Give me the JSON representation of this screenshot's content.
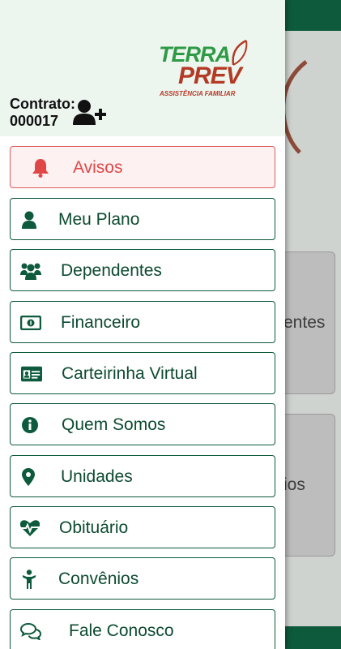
{
  "header": {
    "logo_terra": "TERRA",
    "logo_prev": "PREV",
    "logo_sub": "ASSISTÊNCIA FAMILIAR",
    "contract_label": "Contrato:",
    "contract_number": "000017",
    "add_user_icon": "user-plus-icon"
  },
  "background": {
    "card1_text": "entes",
    "card2_text": "ios"
  },
  "menu": {
    "items": [
      {
        "label": "Avisos",
        "icon": "bell-icon"
      },
      {
        "label": "Meu Plano",
        "icon": "user-icon"
      },
      {
        "label": "Dependentes",
        "icon": "users-icon"
      },
      {
        "label": "Financeiro",
        "icon": "money-bill-icon"
      },
      {
        "label": "Carteirinha Virtual",
        "icon": "id-card-icon"
      },
      {
        "label": "Quem Somos",
        "icon": "info-circle-icon"
      },
      {
        "label": "Unidades",
        "icon": "map-marker-icon"
      },
      {
        "label": "Obituário",
        "icon": "heartbeat-icon"
      },
      {
        "label": "Convênios",
        "icon": "child-icon"
      },
      {
        "label": "Fale Conosco",
        "icon": "comments-icon"
      }
    ]
  },
  "colors": {
    "primary": "#0d5a3c",
    "alert": "#e04848",
    "header_bg": "#edf5ef"
  }
}
